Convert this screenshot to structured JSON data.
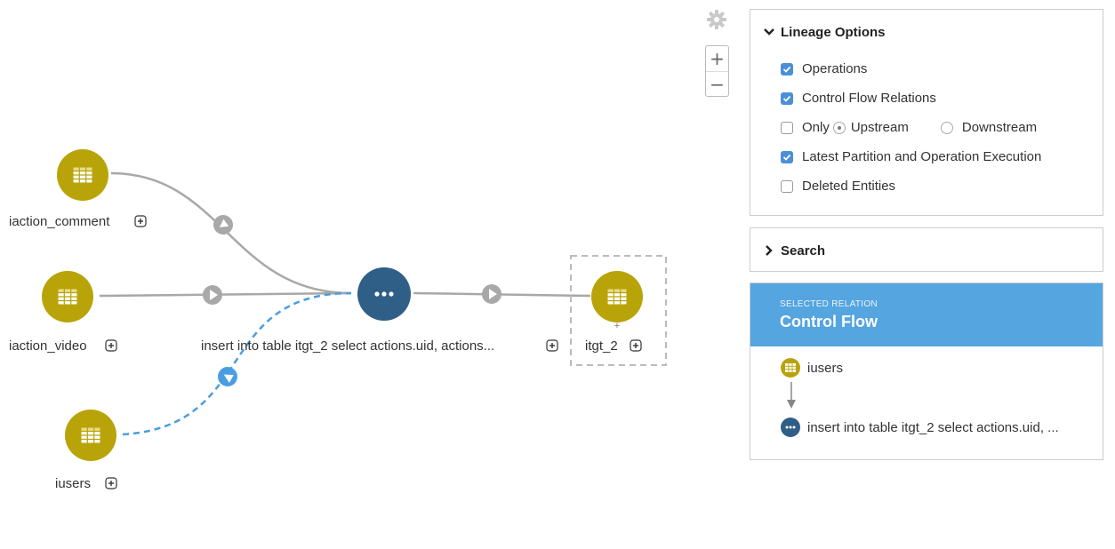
{
  "graph": {
    "nodes": [
      {
        "id": "iaction_comment",
        "label": "iaction_comment",
        "kind": "table"
      },
      {
        "id": "iaction_video",
        "label": "iaction_video",
        "kind": "table"
      },
      {
        "id": "iusers",
        "label": "iusers",
        "kind": "table"
      },
      {
        "id": "operation",
        "label": "insert into table itgt_2 select actions.uid, actions...",
        "kind": "operation"
      },
      {
        "id": "itgt_2",
        "label": "itgt_2",
        "kind": "table"
      }
    ],
    "colors": {
      "table_node": "#b8a409",
      "operation_node": "#2f5f87",
      "edge": "#a8a8a8",
      "control_flow_edge": "#4a9ee0",
      "selection_border": "#bbbbbb"
    }
  },
  "zoom": {
    "in_label": "+",
    "out_label": "−"
  },
  "lineage_options": {
    "title": "Lineage Options",
    "operations": {
      "label": "Operations",
      "checked": true
    },
    "control_flow": {
      "label": "Control Flow Relations",
      "checked": true
    },
    "only": {
      "label": "Only",
      "checked": false
    },
    "upstream": {
      "label": "Upstream",
      "selected": true
    },
    "downstream": {
      "label": "Downstream",
      "selected": false
    },
    "latest_partition": {
      "label": "Latest Partition and Operation Execution",
      "checked": true
    },
    "deleted_entities": {
      "label": "Deleted Entities",
      "checked": false
    }
  },
  "search": {
    "title": "Search"
  },
  "selected_relation": {
    "subtitle": "SELECTED RELATION",
    "title": "Control Flow",
    "from": "iusers",
    "to": "insert into table itgt_2 select actions.uid, ..."
  }
}
